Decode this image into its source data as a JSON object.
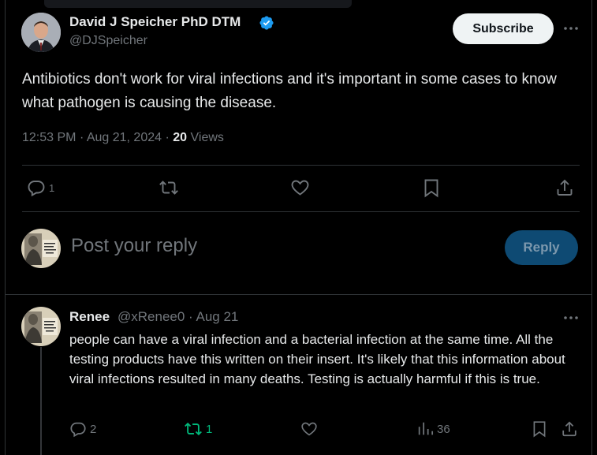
{
  "post": {
    "author_name": "David J Speicher PhD DTM",
    "handle": "@DJSpeicher",
    "subscribe_label": "Subscribe",
    "text": "Antibiotics don't work for viral infections and it's important in some cases to know what pathogen is causing the disease.",
    "time": "12:53 PM",
    "date": "Aug 21, 2024",
    "views_count": "20",
    "views_label": "Views",
    "reply_count": "1"
  },
  "composer": {
    "placeholder": "Post your reply",
    "reply_label": "Reply"
  },
  "reply": {
    "name": "Renee",
    "handle": "@xRenee0",
    "date": "Aug 21",
    "text": "people can have a viral infection and a bacterial infection at the same time. All the testing products have this written on their insert. It's likely that this information about viral infections resulted in many deaths. Testing is actually harmful if this is true.",
    "reply_count": "2",
    "repost_count": "1",
    "views_count": "36"
  },
  "colors": {
    "background": "#000000",
    "text_primary": "#e7e9ea",
    "text_secondary": "#71767b",
    "verified_blue": "#1d9bf0",
    "repost_green": "#00ba7c",
    "reply_button_bg": "#0e4a73"
  },
  "icons": [
    "verified-badge-icon",
    "more-icon",
    "reply-icon",
    "repost-icon",
    "like-icon",
    "bookmark-icon",
    "share-icon",
    "views-icon"
  ]
}
